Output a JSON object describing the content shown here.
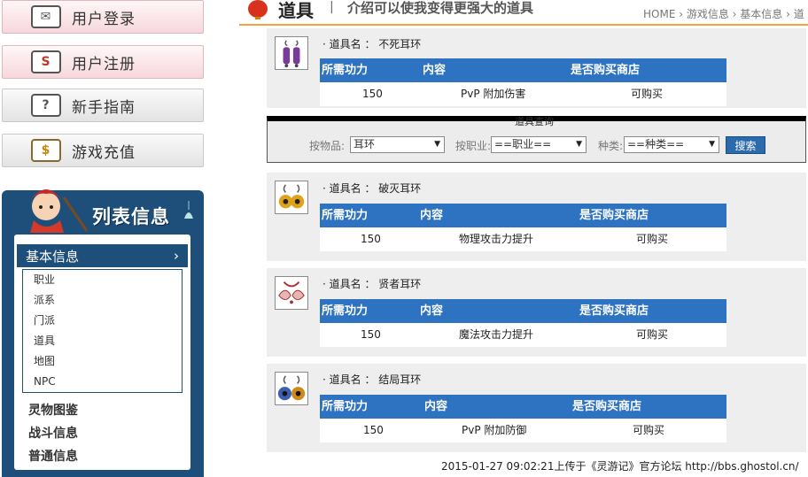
{
  "sidebar": {
    "buttons": [
      {
        "label": "用户登录",
        "icon": "mail-icon"
      },
      {
        "label": "用户注册",
        "icon": "register-icon"
      },
      {
        "label": "新手指南",
        "icon": "question-icon"
      },
      {
        "label": "游戏充值",
        "icon": "dollar-icon"
      }
    ],
    "list_title": "列表信息",
    "basic_info": "基本信息",
    "basic_arrow": "›",
    "sub_items": [
      "职业",
      "派系",
      "门派",
      "道具",
      "地图",
      "NPC"
    ],
    "categories": [
      "灵物图鉴",
      "战斗信息",
      "普通信息"
    ]
  },
  "header": {
    "title": "道具",
    "separator": "|",
    "subtitle": "介绍可以使我变得更强大的道具",
    "breadcrumb": "HOME › 游戏信息 › 基本信息 › 道"
  },
  "item_name_prefix": "· 道具名 ：",
  "table_headers": {
    "power": "所需功力",
    "content": "内容",
    "shop": "是否购买商店"
  },
  "items": [
    {
      "name": "不死耳环",
      "power": "150",
      "content": "PvP 附加伤害",
      "shop": "可购买"
    },
    {
      "name": "破灭耳环",
      "power": "150",
      "content": "物理攻击力提升",
      "shop": "可购买"
    },
    {
      "name": "贤者耳环",
      "power": "150",
      "content": "魔法攻击力提升",
      "shop": "可购买"
    },
    {
      "name": "结局耳环",
      "power": "150",
      "content": "PvP 附加防御",
      "shop": "可购买"
    }
  ],
  "search": {
    "title": "道具查询",
    "item_label": "按物品:",
    "item_value": "耳环",
    "job_label": "按职业:",
    "job_value": "==职业==",
    "type_label": "种类:",
    "type_value": "==种类==",
    "button": "搜索",
    "arrow": "▼"
  },
  "footer": "2015-01-27 09:02:21上传于《灵游记》官方论坛 http://bbs.ghostol.cn/",
  "colors": {
    "header_blue": "#2e73c2",
    "panel_navy": "#1e4f7b",
    "accent_orange": "#f1a23a"
  }
}
